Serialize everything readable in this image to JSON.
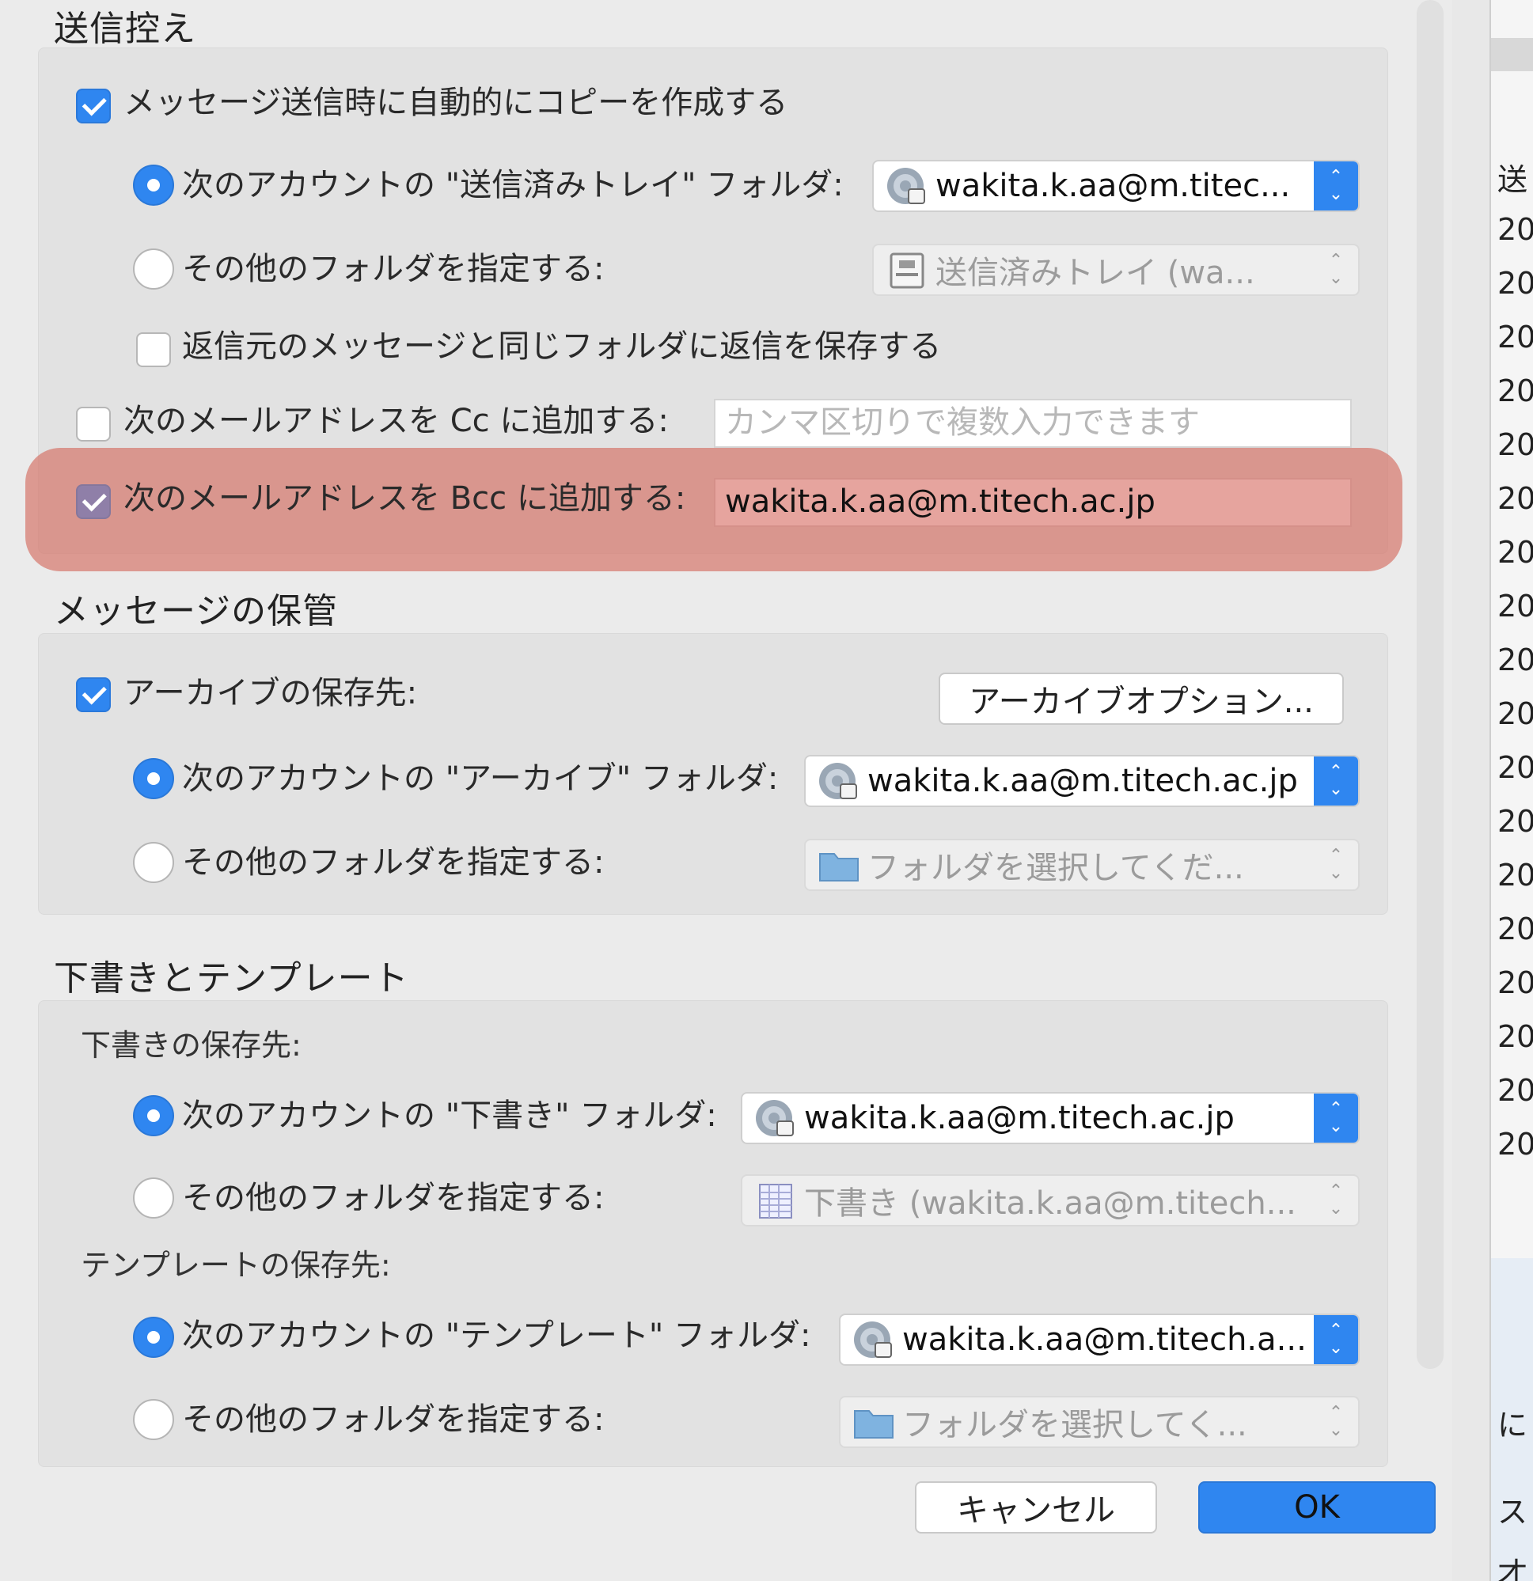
{
  "sections": {
    "sent": {
      "title": "送信控え",
      "auto_copy_label": "メッセージ送信時に自動的にコピーを作成する",
      "account_sent_label": "次のアカウントの \"送信済みトレイ\" フォルダ:",
      "account_sent_value": "wakita.k.aa@m.titec...",
      "other_folder_label": "その他のフォルダを指定する:",
      "other_folder_value": "送信済みトレイ (wa...",
      "reply_same_folder_label": "返信元のメッセージと同じフォルダに返信を保存する",
      "cc_label": "次のメールアドレスを Cc に追加する:",
      "cc_placeholder": "カンマ区切りで複数入力できます",
      "bcc_label": "次のメールアドレスを Bcc に追加する:",
      "bcc_value": "wakita.k.aa@m.titech.ac.jp"
    },
    "archive": {
      "title": "メッセージの保管",
      "archive_label": "アーカイブの保存先:",
      "archive_options_button": "アーカイブオプション...",
      "account_archive_label": "次のアカウントの \"アーカイブ\" フォルダ:",
      "account_archive_value": "wakita.k.aa@m.titech.ac.jp",
      "other_folder_label": "その他のフォルダを指定する:",
      "other_folder_value": "フォルダを選択してくだ..."
    },
    "drafts": {
      "title": "下書きとテンプレート",
      "drafts_location_label": "下書きの保存先:",
      "account_drafts_label": "次のアカウントの \"下書き\" フォルダ:",
      "account_drafts_value": "wakita.k.aa@m.titech.ac.jp",
      "other_folder_label": "その他のフォルダを指定する:",
      "other_folder_value": "下書き (wakita.k.aa@m.titech...",
      "templates_location_label": "テンプレートの保存先:",
      "account_templates_label": "次のアカウントの \"テンプレート\" フォルダ:",
      "account_templates_value": "wakita.k.aa@m.titech.a...",
      "other_folder2_label": "その他のフォルダを指定する:",
      "other_folder2_value": "フォルダを選択してく..."
    }
  },
  "buttons": {
    "cancel": "キャンセル",
    "ok": "OK"
  },
  "background_window": {
    "header": "送",
    "rows": [
      "20",
      "20",
      "20",
      "20",
      "20",
      "20",
      "20",
      "20",
      "20",
      "20",
      "20",
      "20",
      "20",
      "20",
      "20",
      "20",
      "20",
      "20"
    ],
    "bottom_fragments": [
      "に",
      "ス",
      "才"
    ]
  },
  "colors": {
    "accent": "#2f86f0",
    "highlight": "#d6786e"
  }
}
